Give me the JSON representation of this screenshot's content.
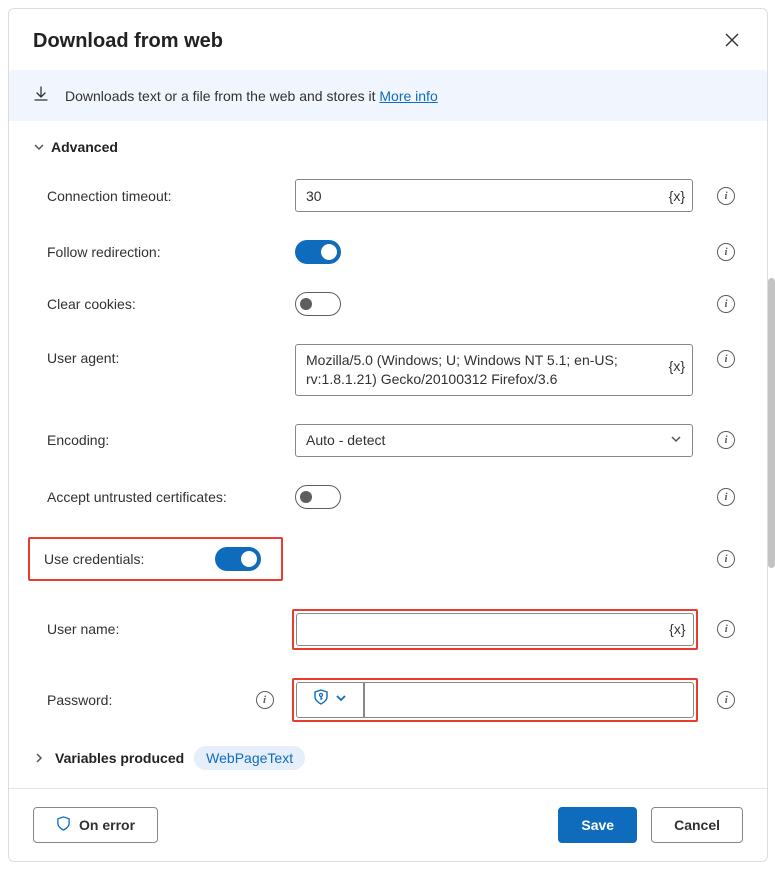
{
  "dialog": {
    "title": "Download from web"
  },
  "banner": {
    "text": "Downloads text or a file from the web and stores it ",
    "link": "More info"
  },
  "sections": {
    "advanced": "Advanced",
    "variables": "Variables produced"
  },
  "fields": {
    "connection_timeout": {
      "label": "Connection timeout:",
      "value": "30"
    },
    "follow_redirection": {
      "label": "Follow redirection:"
    },
    "clear_cookies": {
      "label": "Clear cookies:"
    },
    "user_agent": {
      "label": "User agent:",
      "value": "Mozilla/5.0 (Windows; U; Windows NT 5.1; en-US; rv:1.8.1.21) Gecko/20100312 Firefox/3.6"
    },
    "encoding": {
      "label": "Encoding:",
      "value": "Auto - detect"
    },
    "accept_untrusted": {
      "label": "Accept untrusted certificates:"
    },
    "use_credentials": {
      "label": "Use credentials:"
    },
    "username": {
      "label": "User name:",
      "value": ""
    },
    "password": {
      "label": "Password:",
      "value": ""
    }
  },
  "variables": {
    "chip": "WebPageText"
  },
  "buttons": {
    "on_error": "On error",
    "save": "Save",
    "cancel": "Cancel"
  },
  "glyphs": {
    "vx": "{x}"
  }
}
